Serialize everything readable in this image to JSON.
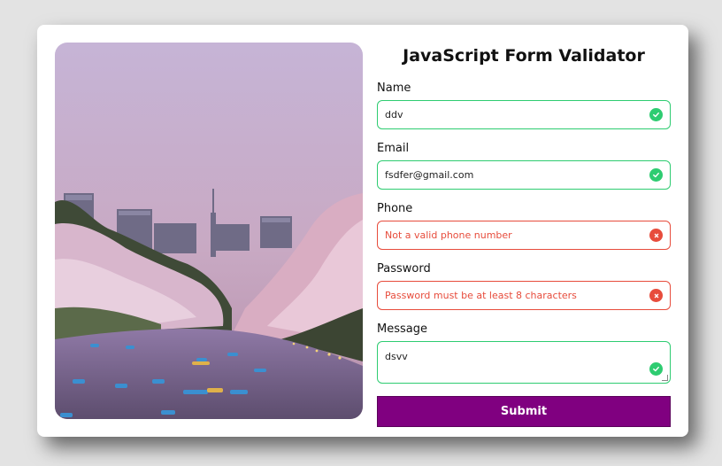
{
  "form": {
    "title": "JavaScript Form Validator",
    "fields": [
      {
        "label": "Name",
        "value": "ddv",
        "placeholder": "",
        "state": "valid"
      },
      {
        "label": "Email",
        "value": "fsdfer@gmail.com",
        "placeholder": "",
        "state": "valid"
      },
      {
        "label": "Phone",
        "value": "",
        "placeholder": "Not a valid phone number",
        "state": "invalid"
      },
      {
        "label": "Password",
        "value": "",
        "placeholder": "Password must be at least 8 characters",
        "state": "invalid"
      },
      {
        "label": "Message",
        "value": "dsvv",
        "placeholder": "",
        "state": "valid"
      }
    ],
    "submit_label": "Submit"
  },
  "icons": {
    "valid": "check-circle-icon",
    "invalid": "x-circle-icon"
  },
  "colors": {
    "accent": "#800080",
    "valid": "#2ecc71",
    "invalid": "#e74c3c",
    "background": "#e3e3e3"
  }
}
